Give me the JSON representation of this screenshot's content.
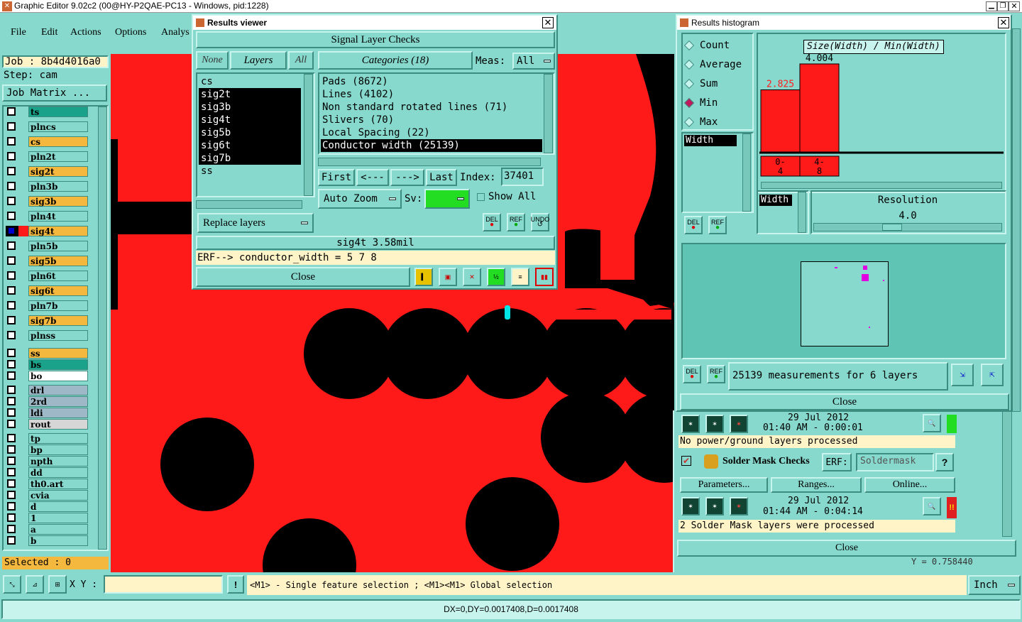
{
  "app": {
    "title": "Graphic Editor 9.02c2 (00@HY-P2QAE-PC13 - Windows, pid:1228)"
  },
  "menu": [
    "File",
    "Edit",
    "Actions",
    "Options",
    "Analys"
  ],
  "left": {
    "job": "Job : 8b4d4016a0",
    "step": "Step: cam",
    "job_matrix": "Job Matrix ...",
    "selected": "Selected : 0",
    "layers": [
      {
        "name": "ts",
        "color": "#1aa38a"
      },
      {
        "name": "plncs",
        "color": "#86d9cc"
      },
      {
        "name": "cs",
        "color": "#f5b83f"
      },
      {
        "name": "pln2t",
        "color": "#86d9cc"
      },
      {
        "name": "sig2t",
        "color": "#f5b83f"
      },
      {
        "name": "pln3b",
        "color": "#86d9cc"
      },
      {
        "name": "sig3b",
        "color": "#f5b83f"
      },
      {
        "name": "pln4t",
        "color": "#86d9cc"
      },
      {
        "name": "sig4t",
        "color": "#f5b83f"
      },
      {
        "name": "pln5b",
        "color": "#86d9cc"
      },
      {
        "name": "sig5b",
        "color": "#f5b83f"
      },
      {
        "name": "pln6t",
        "color": "#86d9cc"
      },
      {
        "name": "sig6t",
        "color": "#f5b83f"
      },
      {
        "name": "pln7b",
        "color": "#86d9cc"
      },
      {
        "name": "sig7b",
        "color": "#f5b83f"
      },
      {
        "name": "plnss",
        "color": "#86d9cc"
      },
      {
        "name": "ss",
        "color": "#f5b83f"
      },
      {
        "name": "bs",
        "color": "#1aa38a"
      },
      {
        "name": "bo",
        "color": "#ffffff"
      },
      {
        "name": "drl",
        "color": "#9fb8c8"
      },
      {
        "name": "2rd",
        "color": "#9fb8c8"
      },
      {
        "name": "ldi",
        "color": "#9fb8c8"
      },
      {
        "name": "rout",
        "color": "#d6d6d6"
      },
      {
        "name": "tp",
        "color": "#86d9cc"
      },
      {
        "name": "bp",
        "color": "#86d9cc"
      },
      {
        "name": "npth",
        "color": "#86d9cc"
      },
      {
        "name": "dd",
        "color": "#86d9cc"
      },
      {
        "name": "th0.art",
        "color": "#86d9cc"
      },
      {
        "name": "cvia",
        "color": "#86d9cc"
      },
      {
        "name": "d",
        "color": "#86d9cc"
      },
      {
        "name": "1",
        "color": "#86d9cc"
      },
      {
        "name": "a",
        "color": "#86d9cc"
      },
      {
        "name": "b",
        "color": "#86d9cc"
      }
    ]
  },
  "results_viewer": {
    "title": "Results viewer",
    "heading": "Signal Layer Checks",
    "none_btn": "None",
    "layers_btn": "Layers",
    "all_btn": "All",
    "categories_btn": "Categories (18)",
    "meas_label": "Meas:",
    "meas_value": "All",
    "layer_list": [
      "cs",
      "sig2t",
      "sig3b",
      "sig4t",
      "sig5b",
      "sig6t",
      "sig7b",
      "ss"
    ],
    "categories": [
      "Pads (8672)",
      "Lines (4102)",
      "Non standard rotated lines (71)",
      "Slivers (70)",
      "Local Spacing (22)",
      "Conductor width (25139)"
    ],
    "first": "First",
    "prev": "<---",
    "next": "--->",
    "last": "Last",
    "index_label": "Index:",
    "index_value": "37401",
    "auto_zoom": "Auto Zoom",
    "sv_label": "Sv:",
    "show_all": "Show All",
    "replace_layers": "Replace layers",
    "del": "DEL",
    "ref": "REF",
    "undo": "UNDO",
    "status": "sig4t 3.58mil",
    "erf": "ERF--> conductor_width = 5 7 8",
    "close": "Close"
  },
  "histogram": {
    "title": "Results histogram",
    "modes": [
      "Count",
      "Average",
      "Sum",
      "Min",
      "Max"
    ],
    "selected_mode": "Min",
    "chart_label": "Size(Width) / Min(Width)",
    "field": "Width",
    "field2": "Width",
    "resolution_label": "Resolution",
    "resolution_value": "4.0",
    "del": "DEL",
    "ref": "REF",
    "measurements": "25139 measurements for 6 layers",
    "close": "Close"
  },
  "chart_data": {
    "type": "bar",
    "categories": [
      "0-\n4",
      "4-\n8"
    ],
    "values": [
      2.825,
      4.004
    ],
    "data_labels": [
      "2.825",
      "4.004"
    ],
    "title": "Size(Width) / Min(Width)"
  },
  "checklist": {
    "date1": "29 Jul 2012",
    "time1": "01:40 AM - 0:00:01",
    "msg1": "No power/ground layers processed",
    "solder_title": "Solder Mask Checks",
    "erf_label": "ERF:",
    "erf_value": "Soldermask",
    "help": "?",
    "parameters": "Parameters...",
    "ranges": "Ranges...",
    "online": "Online...",
    "date2": "29 Jul 2012",
    "time2": "01:44 AM - 0:04:14",
    "msg2": "2 Solder Mask layers were processed",
    "alert": "!!",
    "close": "Close",
    "coord_y": "Y = 0.758440"
  },
  "bottom": {
    "xy_label": "X Y :",
    "hint": "<M1> - Single feature selection ; <M1><M1> Global selection",
    "unit": "Inch",
    "status": "DX=0,DY=0.0017408,D=0.0017408"
  },
  "colors": {
    "panel": "#86d9cc",
    "copper": "#ff1a1a",
    "hole": "#000000",
    "highlight": "#00e5e5"
  }
}
